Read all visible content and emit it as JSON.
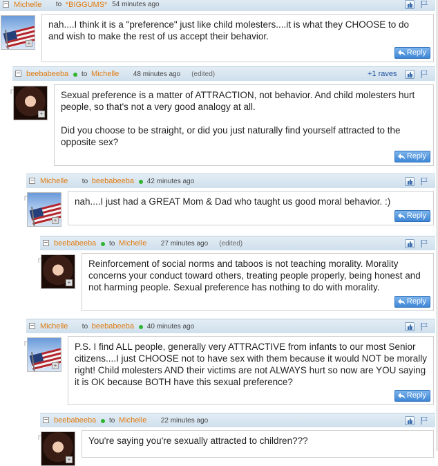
{
  "labels": {
    "to": "to",
    "reply": "Reply",
    "edited": "(edited)"
  },
  "comments": [
    {
      "author": "Michelle",
      "recipient": "*BIGGUMS*",
      "time": "54 minutes ago",
      "online": false,
      "edited": false,
      "raves": "",
      "avatar": "flag",
      "paragraphs": [
        "nah....I think it is a \"preference\" just like child molesters....it is what they CHOOSE to do and wish to make the rest of us accept their behavior."
      ]
    },
    {
      "author": "beebabeeba",
      "recipient": "Michelle",
      "time": "48 minutes ago",
      "online": true,
      "edited": true,
      "raves": "+1 raves",
      "avatar": "woman",
      "paragraphs": [
        "Sexual preference is a matter of ATTRACTION, not behavior. And child molesters hurt people, so that's not a very good analogy at all.",
        "Did you choose to be straight, or did you just naturally find yourself attracted to the opposite sex?"
      ]
    },
    {
      "author": "Michelle",
      "recipient": "beebabeeba",
      "time": "42 minutes ago",
      "online": false,
      "edited": false,
      "raves": "",
      "avatar": "flag",
      "paragraphs": [
        "nah....I just had a GREAT Mom & Dad who taught us good moral behavior. :)"
      ]
    },
    {
      "author": "beebabeeba",
      "recipient": "Michelle",
      "time": "27 minutes ago",
      "online": true,
      "edited": true,
      "raves": "",
      "avatar": "woman",
      "paragraphs": [
        "Reinforcement of social norms and taboos is not teaching morality. Morality concerns your conduct toward others, treating people properly, being honest and not harming people. Sexual preference has nothing to do with morality."
      ]
    },
    {
      "author": "Michelle",
      "recipient": "beebabeeba",
      "time": "40 minutes ago",
      "online": false,
      "edited": false,
      "raves": "",
      "avatar": "flag",
      "paragraphs": [
        "P.S. I find ALL people, generally very ATTRACTIVE from infants to our most Senior citizens....I just CHOOSE not to have sex with them because it would NOT be morally right! Child molesters AND their victims are not ALWAYS hurt so now are YOU saying it is OK because BOTH have this sexual preference?"
      ]
    },
    {
      "author": "beebabeeba",
      "recipient": "Michelle",
      "time": "22 minutes ago",
      "online": true,
      "edited": false,
      "raves": "",
      "avatar": "woman",
      "paragraphs": [
        "You're saying you're sexually attracted to children???"
      ]
    }
  ]
}
